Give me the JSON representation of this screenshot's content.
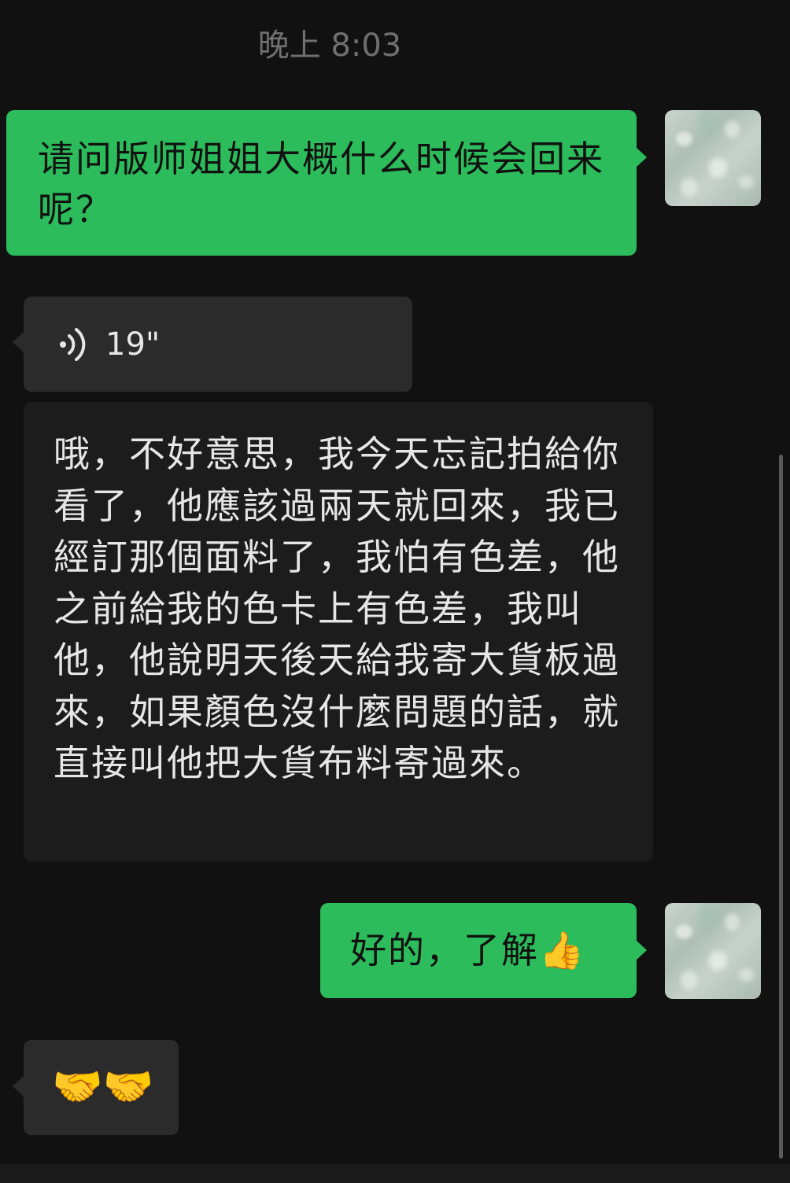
{
  "chat": {
    "timestamp": "晚上 8:03",
    "messages": [
      {
        "direction": "outgoing",
        "type": "text",
        "text": "请问版师姐姐大概什么时候会回来呢？"
      },
      {
        "direction": "incoming",
        "type": "voice",
        "duration": "19\"",
        "icon": "voice-wave-icon"
      },
      {
        "direction": "incoming",
        "type": "text",
        "text": "哦，不好意思，我今天忘記拍給你看了，他應該過兩天就回來，我已經訂那個面料了，我怕有色差，他之前給我的色卡上有色差，我叫他，他說明天後天給我寄大貨板過來，如果顏色沒什麼問題的話，就直接叫他把大貨布料寄過來。"
      },
      {
        "direction": "outgoing",
        "type": "text",
        "text": "好的，了解👍"
      },
      {
        "direction": "incoming",
        "type": "emoji",
        "text": "🤝🤝"
      }
    ]
  },
  "colors": {
    "background": "#111111",
    "outgoing_bubble": "#2cbc5b",
    "incoming_bubble": "#2b2b2b",
    "timestamp_text": "#6f6f6f"
  }
}
